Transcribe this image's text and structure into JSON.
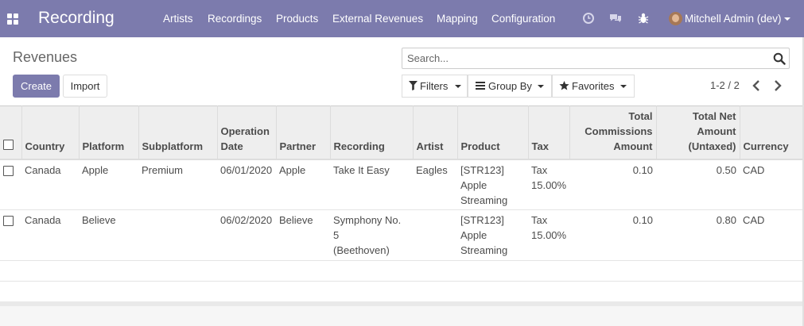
{
  "navbar": {
    "brand": "Recording",
    "menu": [
      "Artists",
      "Recordings",
      "Products",
      "External Revenues",
      "Mapping",
      "Configuration"
    ],
    "user": "Mitchell Admin (dev)",
    "icons": [
      "apps-icon",
      "clock-icon",
      "chat-icon",
      "bug-icon",
      "avatar"
    ]
  },
  "control": {
    "title": "Revenues",
    "create_label": "Create",
    "import_label": "Import",
    "search_placeholder": "Search...",
    "filters_label": "Filters",
    "groupby_label": "Group By",
    "favorites_label": "Favorites",
    "pager": "1-2 / 2"
  },
  "table": {
    "headers": {
      "country": "Country",
      "platform": "Platform",
      "subplatform": "Subplatform",
      "op_date_1": "Operation",
      "op_date_2": "Date",
      "partner": "Partner",
      "recording": "Recording",
      "artist": "Artist",
      "product": "Product",
      "tax": "Tax",
      "commissions_1": "Total",
      "commissions_2": "Commissions",
      "commissions_3": "Amount",
      "net_1": "Total Net",
      "net_2": "Amount",
      "net_3": "(Untaxed)",
      "currency": "Currency"
    },
    "rows": [
      {
        "country": "Canada",
        "platform": "Apple",
        "subplatform": "Premium",
        "operation_date": "06/01/2020",
        "partner": "Apple",
        "recording_1": "Take It Easy",
        "recording_2": "",
        "artist": "Eagles",
        "product_1": "[STR123]",
        "product_2": "Apple",
        "product_3": "Streaming",
        "tax_1": "Tax",
        "tax_2": "15.00%",
        "commissions": "0.10",
        "net_amount": "0.50",
        "currency": "CAD"
      },
      {
        "country": "Canada",
        "platform": "Believe",
        "subplatform": "",
        "operation_date": "06/02/2020",
        "partner": "Believe",
        "recording_1": "Symphony No. 5",
        "recording_2": "(Beethoven)",
        "artist": "",
        "product_1": "[STR123]",
        "product_2": "Apple",
        "product_3": "Streaming",
        "tax_1": "Tax",
        "tax_2": "15.00%",
        "commissions": "0.10",
        "net_amount": "0.80",
        "currency": "CAD"
      }
    ]
  },
  "colors": {
    "navbar": "#7c7bad",
    "primary_button": "#7c7bad",
    "header_bg": "#eeeeee"
  }
}
